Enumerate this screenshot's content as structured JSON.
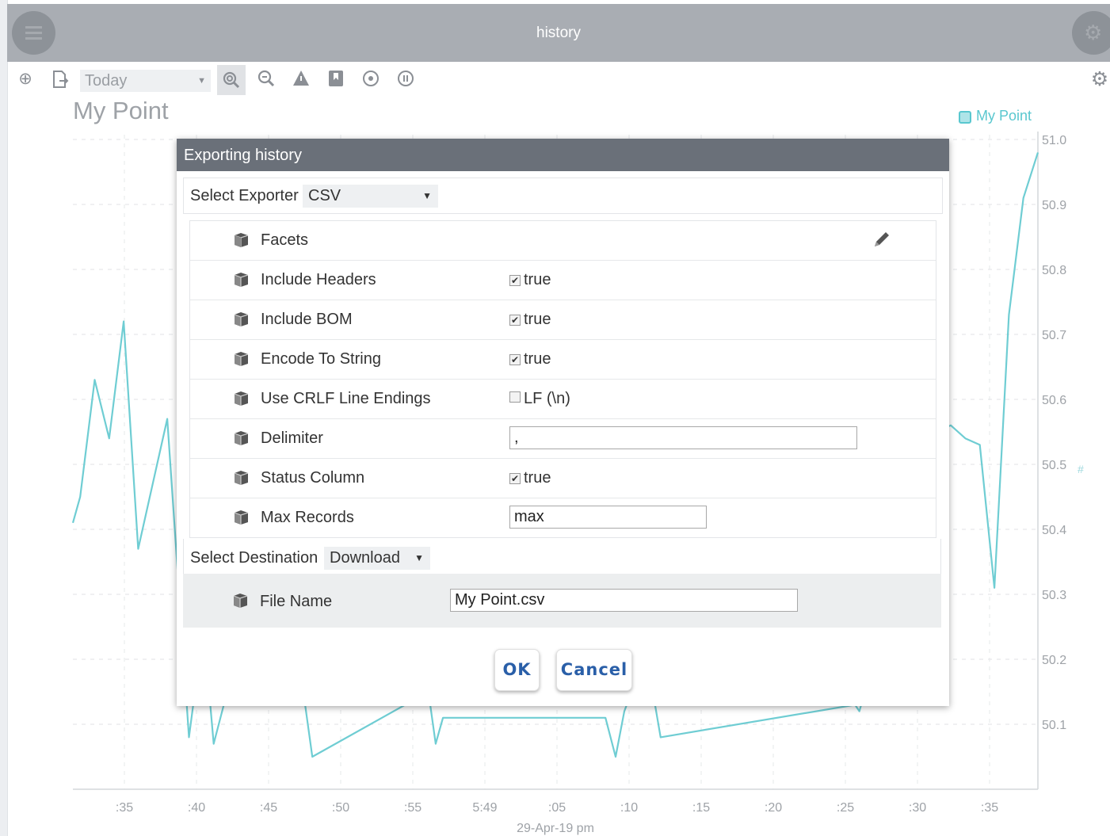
{
  "window": {
    "title": "history"
  },
  "toolbar": {
    "range": "Today",
    "icons": [
      "add-circle-icon",
      "export-icon",
      "zoom-fit-icon",
      "zoom-icon",
      "warning-icon",
      "bookmark-icon",
      "target-icon",
      "pause-icon",
      "settings-icon"
    ]
  },
  "chart": {
    "title": "My Point",
    "legend": "My Point",
    "date_label": "29-Apr-19 pm",
    "line_color": "#6fcdd3"
  },
  "chart_data": {
    "type": "line",
    "title": "My Point",
    "xlabel": "29-Apr-19 pm",
    "ylim": [
      50.0,
      51.0
    ],
    "y_ticks": [
      "51.0",
      "50.9",
      "50.8",
      "50.7",
      "50.6",
      "50.5",
      "50.4",
      "50.3",
      "50.2",
      "50.1"
    ],
    "x_ticks": [
      ":35",
      ":40",
      ":45",
      ":50",
      ":55",
      "5:49",
      ":05",
      ":10",
      ":15",
      ":20",
      ":25",
      ":30",
      ":35"
    ],
    "series": [
      {
        "name": "My Point",
        "x": [
          0,
          0.5,
          1.5,
          2.5,
          3.5,
          4.5,
          6.5,
          8,
          9,
          9.7,
          10.4,
          16,
          16.5,
          24.5,
          25,
          25.5,
          36.7,
          37.4,
          38,
          39.5,
          40.5,
          53.9,
          54.2,
          59.5,
          60.5,
          61.5,
          62.5,
          63.5,
          64.5,
          65.5,
          66.5
        ],
        "y": [
          50.41,
          50.45,
          50.63,
          50.54,
          50.72,
          50.37,
          50.57,
          50.08,
          50.25,
          50.07,
          50.13,
          50.13,
          50.05,
          50.15,
          50.07,
          50.11,
          50.11,
          50.05,
          50.12,
          50.21,
          50.08,
          50.13,
          50.12,
          50.55,
          50.56,
          50.54,
          50.53,
          50.31,
          50.73,
          50.91,
          50.98
        ]
      }
    ]
  },
  "dialog": {
    "title": "Exporting history",
    "exporter_label": "Select Exporter",
    "exporter_value": "CSV",
    "properties": [
      {
        "label": "Facets"
      },
      {
        "label": "Include Headers",
        "value": "true",
        "checked": true
      },
      {
        "label": "Include BOM",
        "value": "true",
        "checked": true
      },
      {
        "label": "Encode To String",
        "value": "true",
        "checked": true
      },
      {
        "label": "Use CRLF Line Endings",
        "value": "LF (\\n)",
        "checked": false
      },
      {
        "label": "Delimiter",
        "value": ","
      },
      {
        "label": "Status Column",
        "value": "true",
        "checked": true
      },
      {
        "label": "Max Records",
        "value": "max"
      }
    ],
    "destination_label": "Select Destination",
    "destination_value": "Download",
    "file_name_label": "File Name",
    "file_name_value": "My Point.csv",
    "ok_label": "OK",
    "cancel_label": "Cancel"
  }
}
